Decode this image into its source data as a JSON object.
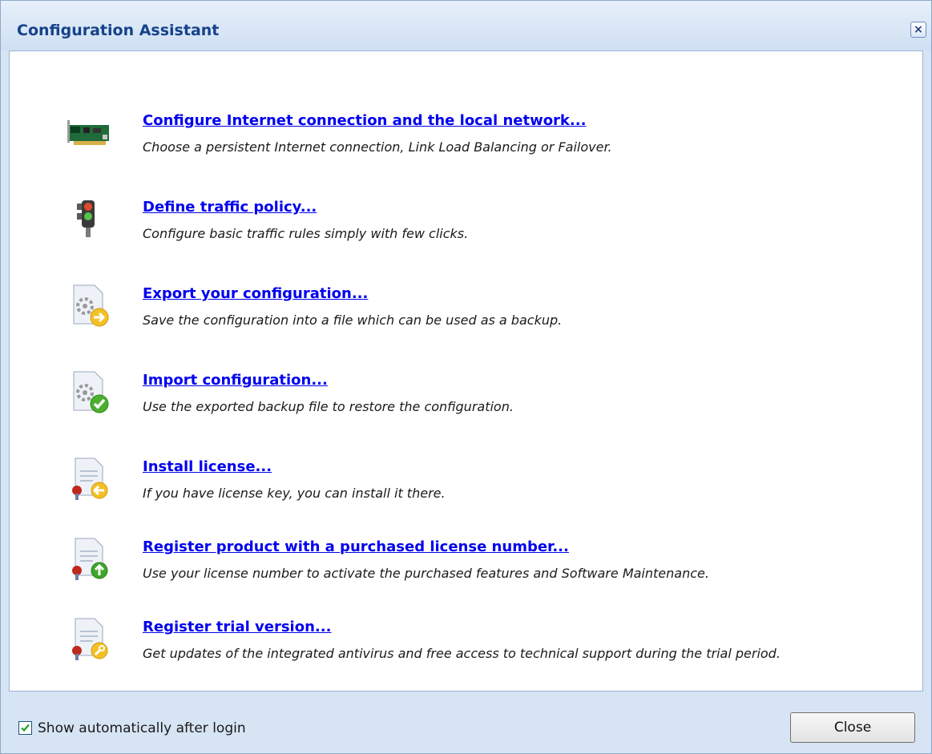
{
  "window": {
    "title": "Configuration Assistant",
    "close_glyph": "×"
  },
  "items": [
    {
      "icon": "network-card-icon",
      "title": "Configure Internet connection and the local network...",
      "description": "Choose a persistent Internet connection, Link Load Balancing or Failover."
    },
    {
      "icon": "traffic-light-icon",
      "title": "Define traffic policy...",
      "description": "Configure basic traffic rules simply with few clicks."
    },
    {
      "icon": "export-config-icon",
      "title": "Export your configuration...",
      "description": "Save the configuration into a file which can be used as a backup."
    },
    {
      "icon": "import-config-icon",
      "title": "Import configuration...",
      "description": "Use the exported backup file to restore the configuration."
    },
    {
      "icon": "install-license-icon",
      "title": "Install license...",
      "description": "If you have license key, you can install it there."
    },
    {
      "icon": "register-product-icon",
      "title": "Register product with a purchased license number...",
      "description": "Use your license number to activate the purchased features and Software Maintenance."
    },
    {
      "icon": "register-trial-icon",
      "title": "Register trial version...",
      "description": "Get updates of the integrated antivirus and free access to technical support during the trial period."
    }
  ],
  "footer": {
    "checkbox_label": "Show automatically after login",
    "checkbox_checked": true,
    "close_label": "Close"
  },
  "colors": {
    "title_text": "#15428b",
    "link": "#0000ee",
    "frame": "#d6e4f4"
  }
}
